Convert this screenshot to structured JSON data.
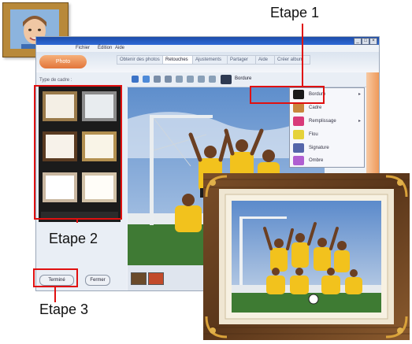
{
  "window": {
    "title": "",
    "menu": [
      "Fichier",
      "Édition",
      "Aide"
    ],
    "logo_text": "Photo",
    "tabs": [
      "Obtenir des photos",
      "Retouches",
      "Ajustements",
      "Partager",
      "Aide",
      "Créer album"
    ],
    "active_tab_index": 1
  },
  "left_panel": {
    "label": "Type de cadre :",
    "footer": ""
  },
  "context_menu": {
    "items": [
      {
        "label": "Bordure",
        "icon": "frame-icon",
        "color": "#1a1a1a",
        "has_submenu": true
      },
      {
        "label": "Cadre",
        "icon": "picture-frame-icon",
        "color": "#c9863c",
        "has_submenu": false
      },
      {
        "label": "Remplissage",
        "icon": "fill-icon",
        "color": "#d83a7a",
        "has_submenu": true
      },
      {
        "label": "Flou",
        "icon": "blur-icon",
        "color": "#e5d23a",
        "has_submenu": false
      },
      {
        "label": "Signature",
        "icon": "signature-icon",
        "color": "#5566aa",
        "has_submenu": false
      },
      {
        "label": "Ombre",
        "icon": "shadow-icon",
        "color": "#b05fd1",
        "has_submenu": false
      }
    ]
  },
  "buttons": {
    "apply": "Terminé",
    "cancel": "Fermer"
  },
  "callouts": {
    "step1": "Etape 1",
    "step2": "Etape 2",
    "step3": "Etape 3"
  },
  "colors": {
    "highlight": "#e01010",
    "accent_orange": "#ef9a5a",
    "titlebar": "#1c4ca9"
  }
}
